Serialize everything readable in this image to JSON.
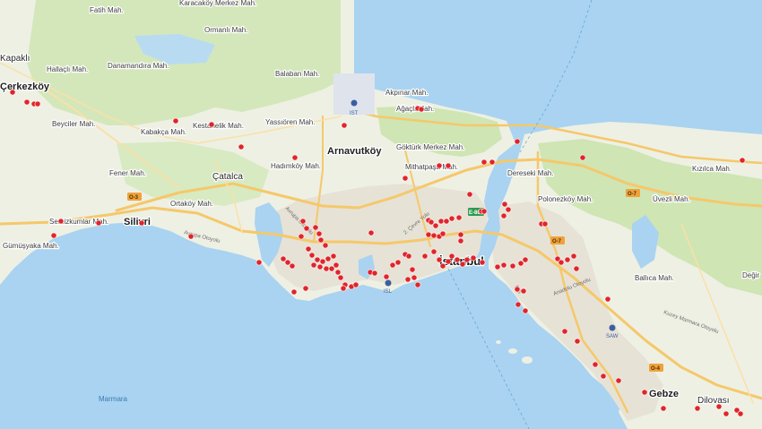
{
  "map": {
    "colors": {
      "sea": "#a9d3f0",
      "land": "#eef0e4",
      "forest": "#cfe5b4",
      "urban": "#e6e1d6",
      "road": "#f5c86a",
      "marker": "#e0252b"
    },
    "labels": [
      {
        "id": "fatih",
        "text": "Fatih Mah.",
        "cls": "lbl"
      },
      {
        "id": "karacakoy",
        "text": "Karacaköy Merkez Mah.",
        "cls": "lbl"
      },
      {
        "id": "ormanli",
        "text": "Ormanlı Mah.",
        "cls": "lbl"
      },
      {
        "id": "kapakli",
        "text": "Kapaklı",
        "cls": "lbl-town"
      },
      {
        "id": "hallacli",
        "text": "Hallaçlı Mah.",
        "cls": "lbl"
      },
      {
        "id": "danamandira",
        "text": "Danamandıra Mah.",
        "cls": "lbl"
      },
      {
        "id": "balaban",
        "text": "Balaban Mah.",
        "cls": "lbl"
      },
      {
        "id": "akpinar",
        "text": "Akpınar Mah.",
        "cls": "lbl"
      },
      {
        "id": "agacli",
        "text": "Ağaçlı Mah.",
        "cls": "lbl"
      },
      {
        "id": "cerkezkoy",
        "text": "Çerkezköy",
        "cls": "lbl-city"
      },
      {
        "id": "beyciler",
        "text": "Beyciler Mah.",
        "cls": "lbl"
      },
      {
        "id": "kestanelik",
        "text": "Kestanelik Mah.",
        "cls": "lbl"
      },
      {
        "id": "yassioren",
        "text": "Yassıören Mah.",
        "cls": "lbl"
      },
      {
        "id": "kabakca",
        "text": "Kabakça Mah.",
        "cls": "lbl"
      },
      {
        "id": "arnavutkoy",
        "text": "Arnavutköy",
        "cls": "lbl-city"
      },
      {
        "id": "gokturk",
        "text": "Göktürk Merkez Mah.",
        "cls": "lbl"
      },
      {
        "id": "mithatpasa",
        "text": "Mithatpaşa Mah.",
        "cls": "lbl"
      },
      {
        "id": "hadimkoy",
        "text": "Hadımköy Mah.",
        "cls": "lbl"
      },
      {
        "id": "deresekli",
        "text": "Dereseki Mah.",
        "cls": "lbl"
      },
      {
        "id": "kizilca",
        "text": "Kızılca Mah.",
        "cls": "lbl"
      },
      {
        "id": "fener",
        "text": "Fener Mah.",
        "cls": "lbl"
      },
      {
        "id": "catalca",
        "text": "Çatalca",
        "cls": "lbl-town"
      },
      {
        "id": "ortakoy",
        "text": "Ortaköy Mah.",
        "cls": "lbl"
      },
      {
        "id": "polonezkoy",
        "text": "Polonezköy Mah.",
        "cls": "lbl"
      },
      {
        "id": "uvezli",
        "text": "Üvezli Mah.",
        "cls": "lbl"
      },
      {
        "id": "semizkumlar",
        "text": "Semizkumlar Mah.",
        "cls": "lbl"
      },
      {
        "id": "silivri",
        "text": "Silivri",
        "cls": "lbl-city"
      },
      {
        "id": "gumusyaka",
        "text": "Gümüşyaka Mah.",
        "cls": "lbl"
      },
      {
        "id": "istanbul",
        "text": "İstanbul",
        "cls": "lbl-big"
      },
      {
        "id": "degir",
        "text": "Değir",
        "cls": "lbl"
      },
      {
        "id": "ballica",
        "text": "Ballıca Mah.",
        "cls": "lbl"
      },
      {
        "id": "gebze",
        "text": "Gebze",
        "cls": "lbl-city"
      },
      {
        "id": "dilovasi",
        "text": "Dilovası",
        "cls": "lbl-town"
      },
      {
        "id": "marmara",
        "text": "Marmara",
        "cls": "lbl-sea"
      }
    ],
    "roads": [
      {
        "id": "avrupa-otoyolu-west",
        "text": "Avrupa Otoyolu"
      },
      {
        "id": "avrupa-otoyolu-north",
        "text": "Avrupa Otoyolu"
      },
      {
        "id": "cevre-yolu",
        "text": "2. Çevre Yolu"
      },
      {
        "id": "anadolu-otoyolu",
        "text": "Anadolu Otoyolu"
      },
      {
        "id": "kuzey-marmara",
        "text": "Kuzey Marmara Otoyolu"
      },
      {
        "id": "e-5-road",
        "text": "E-5"
      }
    ],
    "shields": [
      {
        "id": "o3",
        "text": "O-3"
      },
      {
        "id": "o7-a",
        "text": "O-7"
      },
      {
        "id": "o7-b",
        "text": "O-7"
      },
      {
        "id": "o4",
        "text": "O-4"
      },
      {
        "id": "e80",
        "text": "E-80"
      }
    ],
    "airports": [
      {
        "id": "ist",
        "text": "IST"
      },
      {
        "id": "isl",
        "text": "ISL"
      },
      {
        "id": "saw",
        "text": "SAW"
      }
    ]
  }
}
